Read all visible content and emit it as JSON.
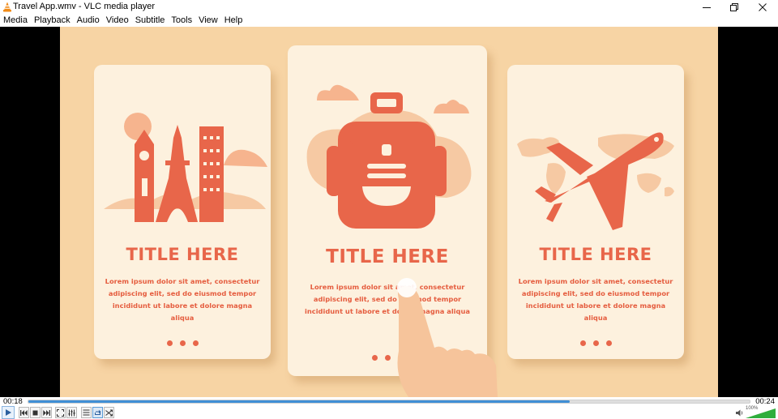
{
  "window": {
    "title": "Travel App.wmv - VLC media player",
    "icons": {
      "app": "vlc-cone-icon",
      "minimize": "minimize-icon",
      "maximize": "restore-icon",
      "close": "close-icon"
    }
  },
  "menu": {
    "items": [
      {
        "label": "Media"
      },
      {
        "label": "Playback"
      },
      {
        "label": "Audio"
      },
      {
        "label": "Video"
      },
      {
        "label": "Subtitle"
      },
      {
        "label": "Tools"
      },
      {
        "label": "View"
      },
      {
        "label": "Help"
      }
    ]
  },
  "video": {
    "cards": [
      {
        "illustration": "landmarks-icon",
        "title": "TITLE HERE",
        "body": [
          "Lorem ipsum dolor sit amet, consectetur",
          "adipiscing elit, sed do eiusmod tempor",
          "incididunt ut labore et dolore magna aliqua"
        ]
      },
      {
        "illustration": "backpack-icon",
        "title": "TITLE HERE",
        "body": [
          "Lorem ipsum dolor sit amet, consectetur",
          "adipiscing elit, sed do eiusmod tempor",
          "incididunt ut labore et dolore magna aliqua"
        ]
      },
      {
        "illustration": "airplane-icon",
        "title": "TITLE HERE",
        "body": [
          "Lorem ipsum dolor sit amet, consectetur",
          "adipiscing elit, sed do eiusmod tempor",
          "incididunt ut labore et dolore magna aliqua"
        ]
      }
    ],
    "colors": {
      "background": "#f7d4a4",
      "card": "#fdf1de",
      "accent": "#e8664a",
      "light_accent": "#f6b48e"
    }
  },
  "playback": {
    "elapsed": "00:18",
    "total": "00:24",
    "progress": 0.75
  },
  "controls": {
    "buttons": [
      {
        "name": "play-button",
        "icon": "play-icon"
      },
      {
        "name": "previous-button",
        "icon": "skip-previous-icon"
      },
      {
        "name": "stop-button",
        "icon": "stop-icon"
      },
      {
        "name": "next-button",
        "icon": "skip-next-icon"
      },
      {
        "name": "fullscreen-button",
        "icon": "fullscreen-icon"
      },
      {
        "name": "extended-settings-button",
        "icon": "equalizer-icon"
      },
      {
        "name": "playlist-button",
        "icon": "playlist-icon"
      },
      {
        "name": "loop-button",
        "icon": "loop-icon"
      },
      {
        "name": "shuffle-button",
        "icon": "shuffle-icon"
      }
    ]
  },
  "volume": {
    "label": "100%",
    "level": 1.0,
    "icon": "speaker-icon"
  }
}
